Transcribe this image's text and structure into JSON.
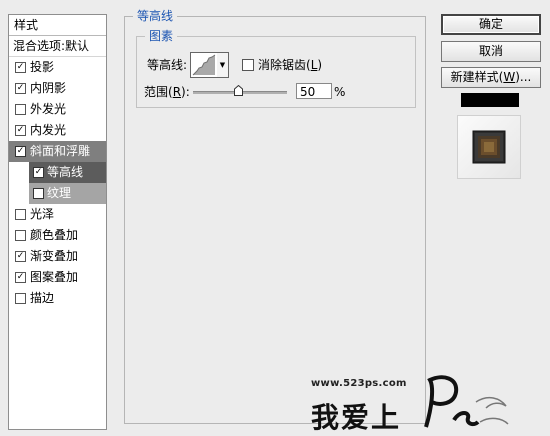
{
  "styles_panel": {
    "title": "样式",
    "blend_options": "混合选项:默认",
    "items": [
      {
        "label": "投影",
        "checked": true
      },
      {
        "label": "内阴影",
        "checked": true
      },
      {
        "label": "外发光",
        "checked": false
      },
      {
        "label": "内发光",
        "checked": true
      },
      {
        "label": "斜面和浮雕",
        "checked": true
      },
      {
        "label": "等高线",
        "checked": true
      },
      {
        "label": "纹理",
        "checked": false
      },
      {
        "label": "光泽",
        "checked": false
      },
      {
        "label": "颜色叠加",
        "checked": false
      },
      {
        "label": "渐变叠加",
        "checked": true
      },
      {
        "label": "图案叠加",
        "checked": true
      },
      {
        "label": "描边",
        "checked": false
      }
    ],
    "check_glyph": "✓"
  },
  "contour_section": {
    "title": "等高线",
    "group_title": "图素",
    "contour_label": "等高线:",
    "anti_alias_label": "消除锯齿(",
    "anti_alias_key": "L",
    "anti_alias_close": ")",
    "anti_alias_checked": false,
    "range_label": "范围(",
    "range_key": "R",
    "range_close": "):",
    "range_value": "50",
    "range_unit": "%",
    "range_fraction": 0.5
  },
  "buttons": {
    "ok": "确定",
    "cancel": "取消",
    "new_style": "新建样式(",
    "new_style_key": "W",
    "new_style_close": ")..."
  },
  "watermark": {
    "url": "www.523ps.com",
    "text": "我爱上",
    "logo": "Ps"
  },
  "colors": {
    "accent_blue": "#1c55b2",
    "active_item": "#7f7f7f",
    "sub_active_item": "#5c5c5c"
  }
}
